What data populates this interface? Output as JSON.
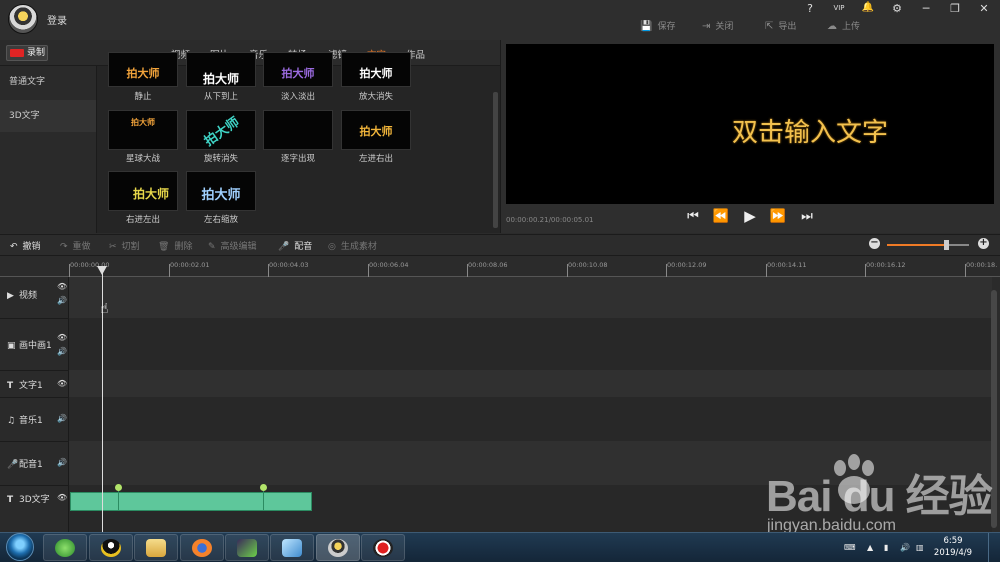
{
  "header": {
    "login": "登录",
    "actions": [
      {
        "label": "保存",
        "icon": "save-icon",
        "glyph": "💾"
      },
      {
        "label": "关闭",
        "icon": "close-project-icon",
        "glyph": "⇥"
      },
      {
        "label": "导出",
        "icon": "export-icon",
        "glyph": "⇱"
      },
      {
        "label": "上传",
        "icon": "upload-icon",
        "glyph": "☁"
      }
    ],
    "window": {
      "help": "?",
      "vip": "VIP",
      "bell": "🔔",
      "settings": "⚙",
      "minimize": "─",
      "restore": "❐",
      "close": "✕"
    }
  },
  "media": {
    "record_label": "录制",
    "tabs": [
      "视频",
      "图片",
      "音乐",
      "转场",
      "滤镜",
      "文字",
      "作品"
    ],
    "active_tab": "文字",
    "categories": [
      "普通文字",
      "3D文字"
    ],
    "effects": [
      {
        "label": "静止",
        "thumb_text": "拍大师",
        "color": "#f3a43b"
      },
      {
        "label": "从下到上",
        "thumb_text": "拍大师",
        "color": "#ffffff"
      },
      {
        "label": "淡入淡出",
        "thumb_text": "拍大师",
        "color": "#9b6be0"
      },
      {
        "label": "放大消失",
        "thumb_text": "拍大师",
        "color": "#ffffff"
      },
      {
        "label": "星球大战",
        "thumb_text": "拍大师",
        "color": "#f3a43b"
      },
      {
        "label": "旋转消失",
        "thumb_text": "拍大师",
        "color": "#3fd3c5"
      },
      {
        "label": "逐字出现",
        "thumb_text": "",
        "color": "#ffffff"
      },
      {
        "label": "左进右出",
        "thumb_text": "拍大师",
        "color": "#f3b63b"
      },
      {
        "label": "右进左出",
        "thumb_text": "拍大师",
        "color": "#e8d84a"
      },
      {
        "label": "左右缩放",
        "thumb_text": "拍大师",
        "color": "#9fd0ff"
      }
    ]
  },
  "preview": {
    "text": "双击输入文字",
    "timecode": "00:00:00.21/00:00:05.01",
    "controls": {
      "first": "⏮",
      "prev_frame": "⏪",
      "play": "▶",
      "next_frame": "⏩",
      "last": "⏭"
    }
  },
  "toolbar": {
    "items": [
      {
        "label": "撤销",
        "glyph": "↶",
        "enabled": true
      },
      {
        "label": "重做",
        "glyph": "↷",
        "enabled": false
      },
      {
        "label": "切割",
        "glyph": "✂",
        "enabled": false
      },
      {
        "label": "删除",
        "glyph": "🗑",
        "enabled": false
      },
      {
        "label": "高级编辑",
        "glyph": "✎",
        "enabled": false
      },
      {
        "label": "配音",
        "glyph": "🎤",
        "enabled": true
      },
      {
        "label": "生成素材",
        "glyph": "◎",
        "enabled": false
      }
    ],
    "zoom": {
      "minus": "−",
      "plus": "+",
      "level": 0.73
    }
  },
  "timeline": {
    "ticks": [
      "00:00:00.00",
      "00:00:02.01",
      "00:00:04.03",
      "00:00:06.04",
      "00:00:08.06",
      "00:00:10.08",
      "00:00:12.09",
      "00:00:14.11",
      "00:00:16.12",
      "00:00:18."
    ],
    "tracks": [
      {
        "label": "视频",
        "glyph": "▶",
        "eye": true,
        "speaker": true
      },
      {
        "label": "画中画1",
        "glyph": "▣",
        "eye": true,
        "speaker": true
      },
      {
        "label": "文字1",
        "glyph": "T",
        "eye": true,
        "speaker": false
      },
      {
        "label": "音乐1",
        "glyph": "♫",
        "eye": false,
        "speaker": true
      },
      {
        "label": "配音1",
        "glyph": "🎤",
        "eye": false,
        "speaker": true
      },
      {
        "label": "3D文字",
        "glyph": "T",
        "eye": true,
        "speaker": false
      }
    ],
    "clip_color": "#5ec79b"
  },
  "taskbar": {
    "time": "6:59",
    "date": "2019/4/9"
  },
  "watermark": {
    "brand": "Bai  du 经验",
    "url": "jingyan.baidu.com"
  }
}
